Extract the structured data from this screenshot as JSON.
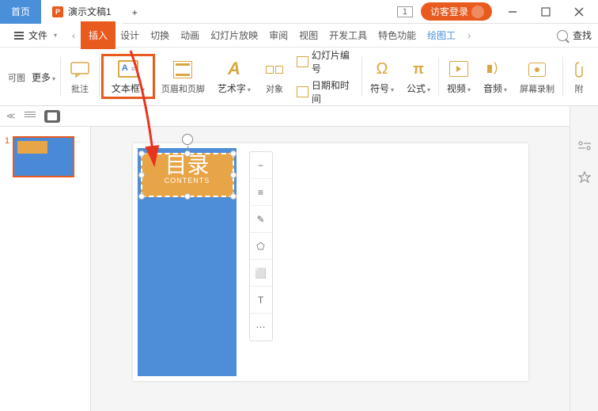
{
  "titlebar": {
    "home_tab": "首页",
    "file_tab": "演示文稿1",
    "new_tab": "+",
    "one_badge": "1",
    "guest_login": "访客登录"
  },
  "menubar": {
    "file": "文件",
    "tabs": [
      "插入",
      "设计",
      "切换",
      "动画",
      "幻灯片放映",
      "审阅",
      "视图",
      "开发工具",
      "特色功能",
      "绘图工"
    ],
    "search": "查找"
  },
  "ribbon": {
    "half_left_1": "可图",
    "half_left_2": "更多",
    "annotate": "批注",
    "textbox": "文本框",
    "header_footer": "页眉和页脚",
    "wordart": "艺术字",
    "object": "对象",
    "slide_number": "幻灯片编号",
    "datetime": "日期和时间",
    "symbol": "符号",
    "formula": "公式",
    "video": "视频",
    "audio": "音频",
    "screen_record": "屏幕录制",
    "attach": "附"
  },
  "slide": {
    "number": "1",
    "title": "目录",
    "subtitle": "CONTENTS"
  },
  "float_tools": [
    "−",
    "≡",
    "✎",
    "⬠",
    "⬜",
    "T",
    "⋯"
  ]
}
